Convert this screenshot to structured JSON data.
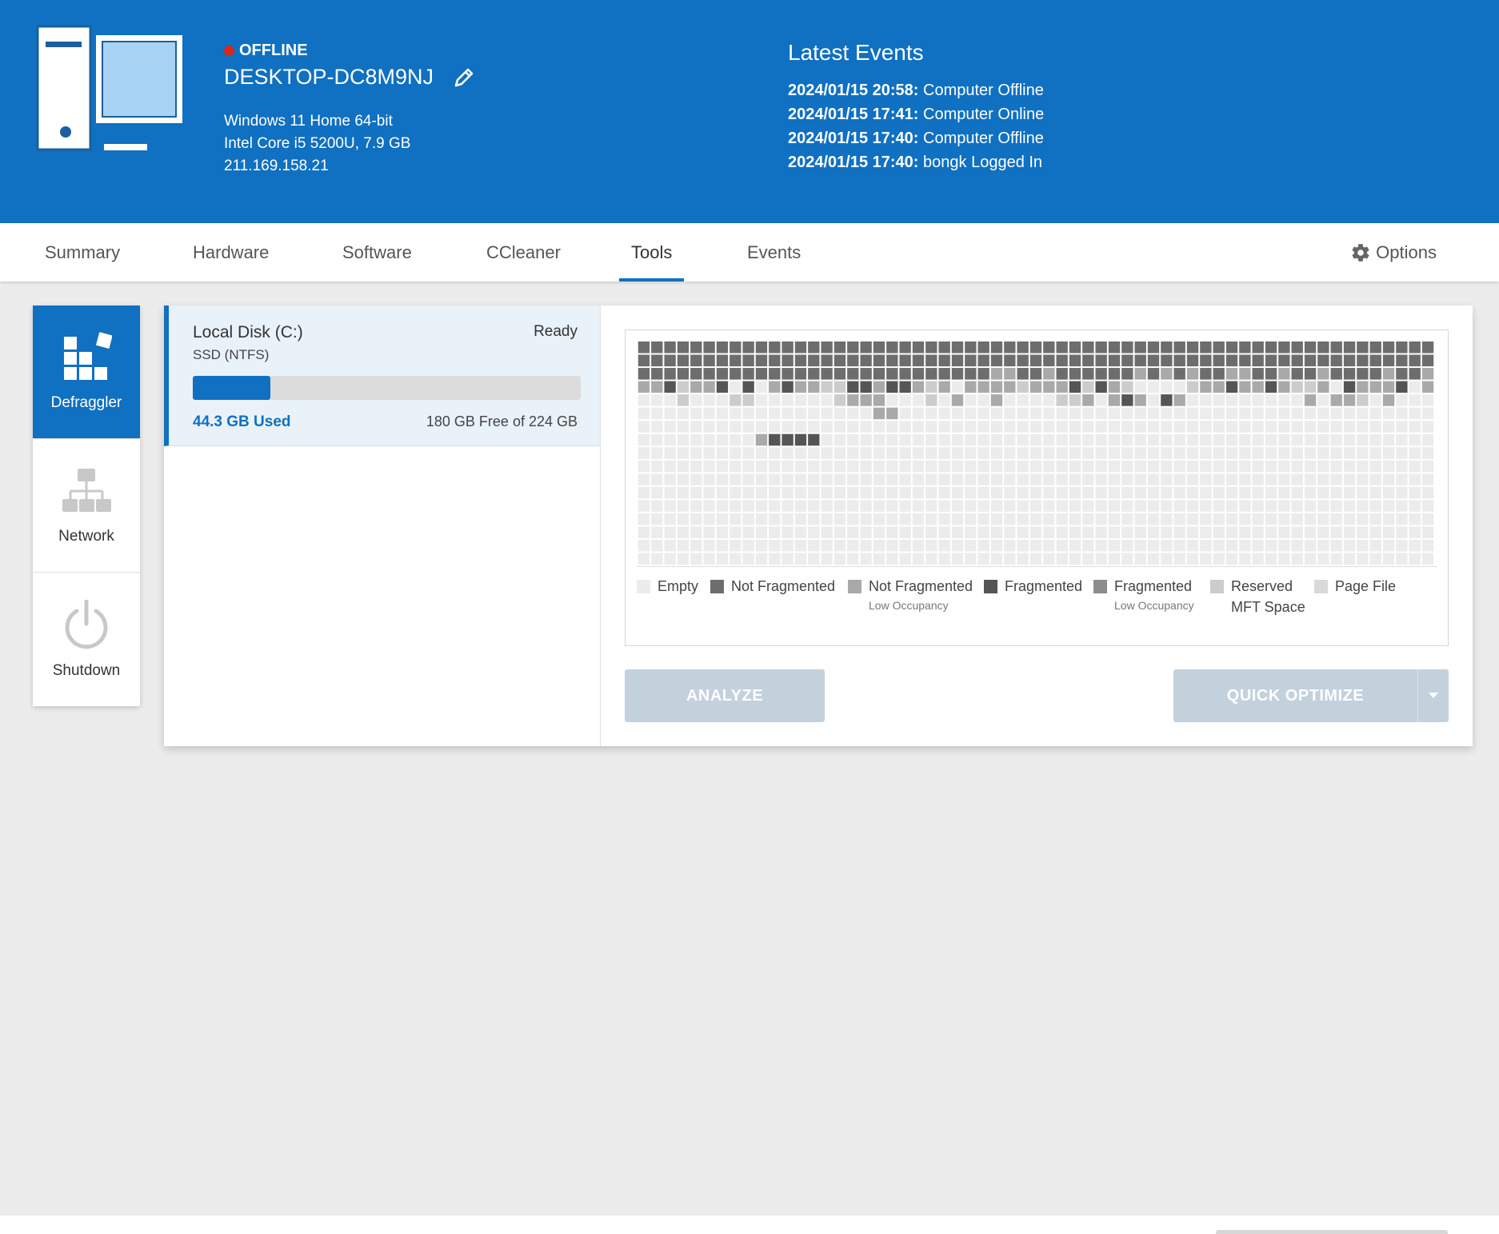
{
  "header": {
    "status": "OFFLINE",
    "hostname": "DESKTOP-DC8M9NJ",
    "os": "Windows 11 Home 64-bit",
    "cpu": "Intel Core i5 5200U, 7.9 GB",
    "ip": "211.169.158.21",
    "status_color": "#d42a1b",
    "brand_color": "#1070c1"
  },
  "events": {
    "title": "Latest Events",
    "items": [
      {
        "time": "2024/01/15 20:58:",
        "text": "Computer Offline"
      },
      {
        "time": "2024/01/15 17:41:",
        "text": "Computer Online"
      },
      {
        "time": "2024/01/15 17:40:",
        "text": "Computer Offline"
      },
      {
        "time": "2024/01/15 17:40:",
        "text": "bongk Logged In"
      }
    ]
  },
  "tabs": {
    "summary": "Summary",
    "hardware": "Hardware",
    "software": "Software",
    "ccleaner": "CCleaner",
    "tools": "Tools",
    "events": "Events",
    "options": "Options",
    "active": "Tools"
  },
  "tools": {
    "defraggler": "Defraggler",
    "network": "Network",
    "shutdown": "Shutdown"
  },
  "disk": {
    "name": "Local Disk (C:)",
    "type": "SSD (NTFS)",
    "status": "Ready",
    "used": "44.3 GB Used",
    "free": "180 GB Free of 224 GB",
    "used_fraction": 0.2
  },
  "legend": {
    "empty": "Empty",
    "not_fragmented": "Not Fragmented",
    "not_fragmented_low": "Not Fragmented",
    "not_fragmented_low_sub": "Low Occupancy",
    "fragmented": "Fragmented",
    "fragmented_low": "Fragmented",
    "fragmented_low_sub": "Low Occupancy",
    "reserved": "Reserved",
    "reserved_sub": "MFT Space",
    "page_file": "Page File",
    "colors": {
      "empty": "#ececec",
      "not_fragmented": "#6d6d6d",
      "not_fragmented_low": "#a9a9a9",
      "fragmented": "#555555",
      "fragmented_low": "#8c8c8c",
      "reserved": "#cccccc",
      "page_file": "#d9d9d9"
    }
  },
  "buttons": {
    "analyze": "ANALYZE",
    "quick_optimize": "QUICK OPTIMIZE"
  }
}
